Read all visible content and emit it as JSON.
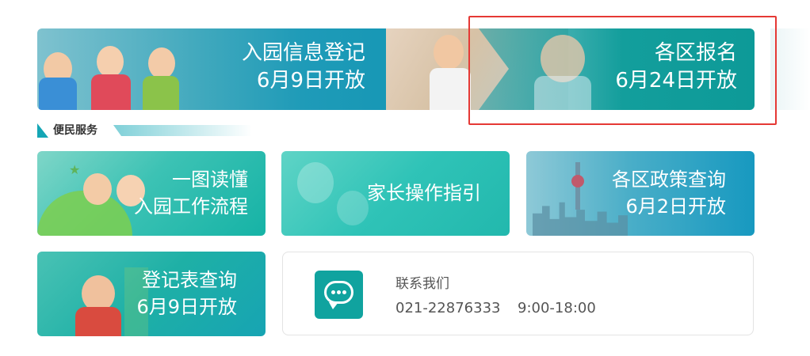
{
  "banner": {
    "left": {
      "line1": "入园信息登记",
      "line2": "6月9日开放"
    },
    "right": {
      "line1": "各区报名",
      "line2": "6月24日开放"
    }
  },
  "section": {
    "title": "便民服务"
  },
  "tiles": [
    {
      "line1": "一图读懂",
      "line2": "入园工作流程"
    },
    {
      "line1": "家长操作指引",
      "line2": ""
    },
    {
      "line1": "各区政策查询",
      "line2": "6月2日开放"
    },
    {
      "line1": "登记表查询",
      "line2": "6月9日开放"
    }
  ],
  "contact": {
    "title": "联系我们",
    "phone": "021-22876333",
    "hours": "9:00-18:00",
    "icon": "chat-bubble-icon"
  },
  "colors": {
    "teal": "#0d9a98",
    "blue_teal": "#0f94b3",
    "highlight": "#e53935"
  }
}
